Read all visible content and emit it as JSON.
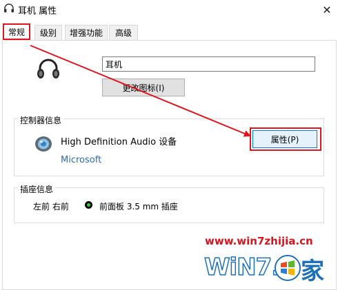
{
  "window": {
    "title": "耳机 属性",
    "close_glyph": "✕"
  },
  "tabs": [
    {
      "label": "常规",
      "active": true
    },
    {
      "label": "级别",
      "active": false
    },
    {
      "label": "增强功能",
      "active": false
    },
    {
      "label": "高级",
      "active": false
    }
  ],
  "general": {
    "device_name_value": "耳机",
    "change_icon_label": "更改图标(I)"
  },
  "controller_info": {
    "group_label": "控制器信息",
    "device_name": "High Definition Audio 设备",
    "manufacturer": "Microsoft",
    "properties_label": "属性(P)"
  },
  "jack_info": {
    "group_label": "插座信息",
    "location": "左前 右前",
    "description": "前面板 3.5 mm 插座",
    "jack_color": "#2bd02b"
  },
  "watermark": {
    "url": "www.win7zhijia.cn",
    "logo_text_left": "WiN7.",
    "logo_text_right": "家"
  },
  "colors": {
    "highlight_red": "#e0141e",
    "link_blue": "#2a6bb5"
  }
}
